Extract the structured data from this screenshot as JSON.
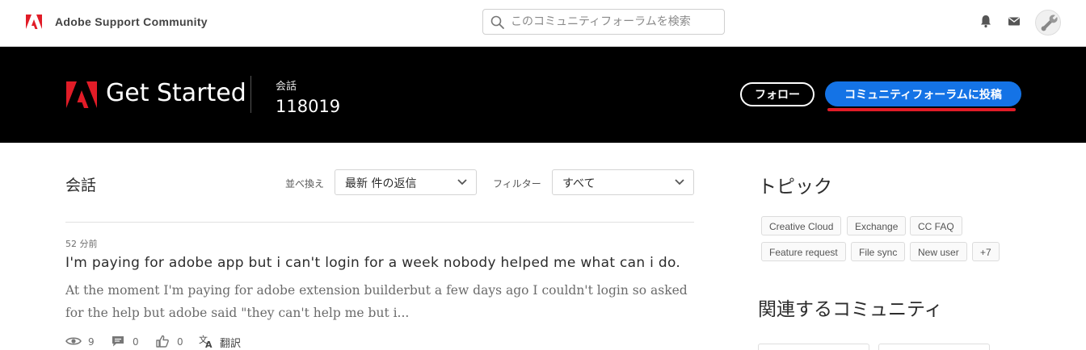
{
  "topbar": {
    "brand": "Adobe Support Community",
    "search_placeholder": "このコミュニティフォーラムを検索"
  },
  "hero": {
    "title": "Get Started",
    "conversations_label": "会話",
    "conversations_count": "118019",
    "follow_label": "フォロー",
    "post_label": "コミュニティフォーラムに投稿"
  },
  "main": {
    "heading": "会話",
    "sort_label": "並べ換え",
    "sort_value": "最新 件の返信",
    "filter_label": "フィルター",
    "filter_value": "すべて"
  },
  "post": {
    "time": "52 分前",
    "title": "I'm paying for adobe app but i can't login for a week nobody helped me what can i do.",
    "excerpt": "At the moment I'm paying for adobe extension builderbut a few days ago I couldn't login so asked for the help but adobe said \"they can't help me but i...",
    "views": "9",
    "replies": "0",
    "likes": "0",
    "translate_label": "翻訳"
  },
  "sidebar": {
    "topics_heading": "トピック",
    "tags": [
      "Creative Cloud",
      "Exchange",
      "CC FAQ",
      "Feature request",
      "File sync",
      "New user",
      "+7"
    ],
    "related_heading": "関連するコミュニティ"
  },
  "colors": {
    "accent_blue": "#1473e6",
    "adobe_red": "#e11c27",
    "hero_bg": "#000000"
  }
}
